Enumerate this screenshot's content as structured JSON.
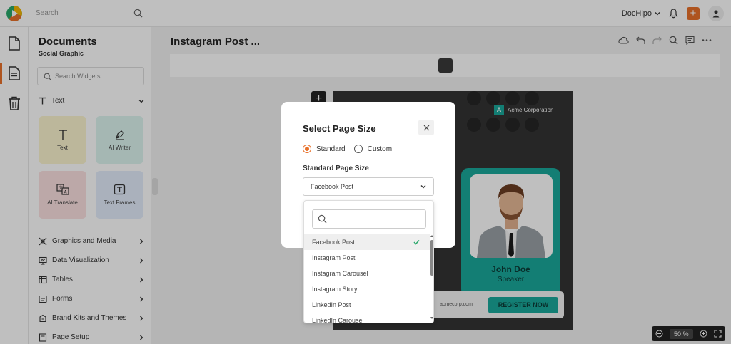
{
  "topbar": {
    "search_placeholder": "Search",
    "brand": "DocHipo",
    "plus": "+"
  },
  "sidebar": {
    "title": "Documents",
    "subtitle": "Social Graphic",
    "widget_search_placeholder": "Search Widgets",
    "text_section": "Text",
    "tiles": [
      {
        "label": "Text"
      },
      {
        "label": "AI Writer"
      },
      {
        "label": "AI Translate"
      },
      {
        "label": "Text Frames"
      }
    ],
    "menu": [
      {
        "label": "Graphics and Media"
      },
      {
        "label": "Data Visualization"
      },
      {
        "label": "Tables"
      },
      {
        "label": "Forms"
      },
      {
        "label": "Brand Kits and Themes"
      },
      {
        "label": "Page Setup"
      }
    ]
  },
  "workspace": {
    "title": "Instagram Post ...",
    "add_page": "+"
  },
  "design": {
    "company": "Acme Corporation",
    "company_logo_letter": "A",
    "name": "John Doe",
    "role": "Speaker",
    "website": "acmecorp.com",
    "cta": "REGISTER NOW"
  },
  "modal": {
    "title": "Select Page Size",
    "radio_standard": "Standard",
    "radio_custom": "Custom",
    "size_label": "Standard Page Size",
    "selected_size": "Facebook Post",
    "options": [
      "Facebook Post",
      "Instagram Post",
      "Instagram Carousel",
      "Instagram Story",
      "LinkedIn Post",
      "LinkedIn Carousel"
    ]
  },
  "zoom": {
    "value": "50",
    "unit": "%"
  },
  "colors": {
    "accent": "#e8702a",
    "teal": "#1aa99b",
    "check": "#2aa86b"
  }
}
